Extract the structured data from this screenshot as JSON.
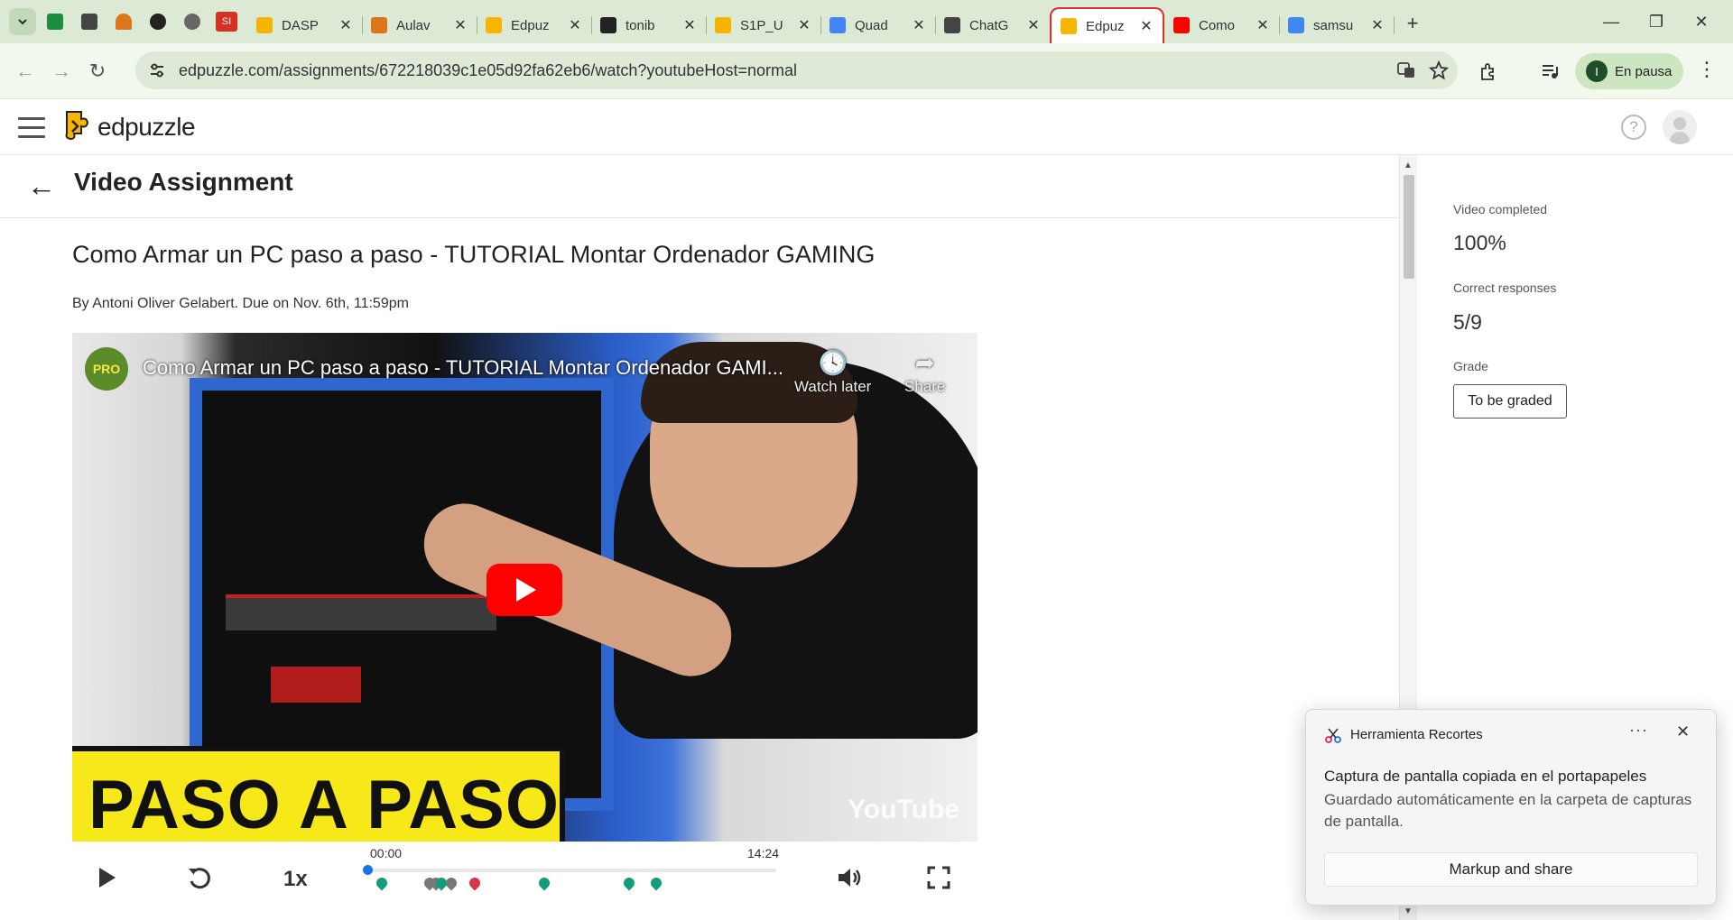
{
  "tabs": [
    {
      "label": "DASP",
      "icon_color": "#f4b400",
      "icon": "slides-icon"
    },
    {
      "label": "Aulav",
      "icon_color": "#e0761a",
      "icon": "moodle-icon"
    },
    {
      "label": "Edpuz",
      "icon_color": "#f7b500",
      "icon": "edpuzzle-icon"
    },
    {
      "label": "tonib",
      "icon_color": "#222222",
      "icon": "github-icon"
    },
    {
      "label": "S1P_U",
      "icon_color": "#f4b400",
      "icon": "slides-icon"
    },
    {
      "label": "Quad",
      "icon_color": "#4285f4",
      "icon": "docs-icon"
    },
    {
      "label": "ChatG",
      "icon_color": "#444444",
      "icon": "chatgpt-icon"
    },
    {
      "label": "Edpuz",
      "icon_color": "#f7b500",
      "icon": "edpuzzle-icon",
      "active": true
    },
    {
      "label": "Como",
      "icon_color": "#ff0000",
      "icon": "youtube-icon"
    },
    {
      "label": "samsu",
      "icon_color": "#4285f4",
      "icon": "google-icon"
    }
  ],
  "pinned_icons": [
    "sheets-icon",
    "classroom-icon",
    "moodle-icon",
    "github-icon",
    "globe-icon",
    "si-icon"
  ],
  "pinned_si_label": "SI",
  "address": {
    "url": "edpuzzle.com/assignments/672218039c1e05d92fa62eb6/watch?youtubeHost=normal"
  },
  "profile": {
    "initial": "I",
    "status": "En pausa"
  },
  "edpuzzle": {
    "brand": "edpuzzle",
    "help_glyph": "?"
  },
  "page": {
    "title": "Video Assignment"
  },
  "assignment": {
    "video_title": "Como Armar un PC paso a paso - TUTORIAL Montar Ordenador GAMING",
    "byline": "By Antoni Oliver Gelabert. Due on Nov. 6th, 11:59pm"
  },
  "player": {
    "overlay_title": "Como Armar un PC paso a paso - TUTORIAL Montar Ordenador GAMI...",
    "channel_badge": "PRO",
    "watch_later": "Watch later",
    "share": "Share",
    "banner": "PASO A PASO",
    "watermark": "YouTube",
    "speed": "1x",
    "time_current": "00:00",
    "time_total": "14:24",
    "progress": 0.0,
    "question_markers": [
      {
        "pos": 0.034,
        "color": "#0f9d7a"
      },
      {
        "pos": 0.15,
        "color": "#777777"
      },
      {
        "pos": 0.165,
        "color": "#777777"
      },
      {
        "pos": 0.18,
        "color": "#0f9d7a"
      },
      {
        "pos": 0.203,
        "color": "#777777"
      },
      {
        "pos": 0.26,
        "color": "#d9344a"
      },
      {
        "pos": 0.432,
        "color": "#0f9d7a"
      },
      {
        "pos": 0.64,
        "color": "#0f9d7a"
      },
      {
        "pos": 0.705,
        "color": "#0f9d7a"
      }
    ]
  },
  "stats": {
    "video_completed_label": "Video completed",
    "video_completed_value": "100%",
    "correct_label": "Correct responses",
    "correct_value": "5/9",
    "grade_label": "Grade",
    "grade_button": "To be graded"
  },
  "toast": {
    "app": "Herramienta Recortes",
    "more": "···",
    "title": "Captura de pantalla copiada en el portapapeles",
    "body": "Guardado automáticamente en la carpeta de capturas de pantalla.",
    "action": "Markup and share"
  }
}
